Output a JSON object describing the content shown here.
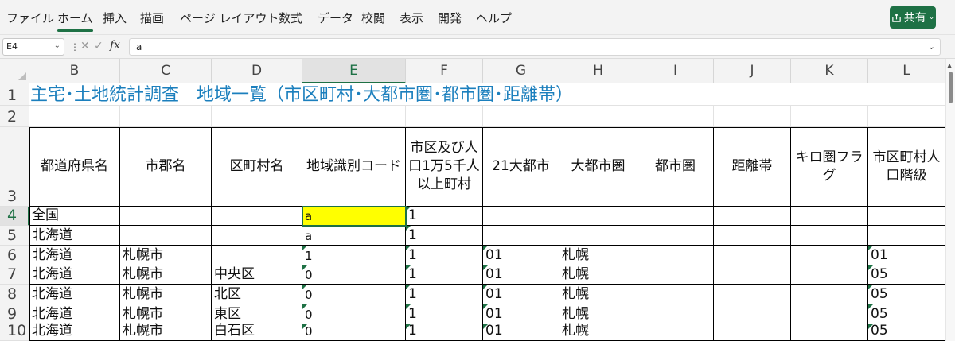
{
  "ribbon": {
    "tabs": [
      "ファイル",
      "ホーム",
      "挿入",
      "描画",
      "ページ レイアウト",
      "数式",
      "データ",
      "校閲",
      "表示",
      "開発",
      "ヘルプ"
    ],
    "active_tab": "ホーム",
    "share_label": "共有",
    "accent_color": "#1e7145"
  },
  "formula_bar": {
    "name_box": "E4",
    "fx_label": "fx",
    "formula": "a"
  },
  "sheet": {
    "columns": [
      "B",
      "C",
      "D",
      "E",
      "F",
      "G",
      "H",
      "I",
      "J",
      "K",
      "L"
    ],
    "selected_column": "E",
    "rows": [
      "1",
      "2",
      "3",
      "4",
      "5",
      "6",
      "7",
      "8",
      "9",
      "10"
    ],
    "selected_row": "4",
    "title": "主宅･土地統計調査　地域一覧（市区町村･大都市圏･都市圏･距離帯）",
    "title_color": "#1b7fbd",
    "headers": [
      "都道府県名",
      "市郡名",
      "区町村名",
      "地域識別コード",
      "市区及び人口1万5千人以上町村",
      "21大都市",
      "大都市圏",
      "都市圏",
      "距離帯",
      "キロ圏フラグ",
      "市区町村人口階級"
    ],
    "data_rows": [
      [
        "全国",
        "",
        "",
        "a",
        "1",
        "",
        "",
        "",
        "",
        "",
        ""
      ],
      [
        "北海道",
        "",
        "",
        "a",
        "1",
        "",
        "",
        "",
        "",
        "",
        ""
      ],
      [
        "北海道",
        "札幌市",
        "",
        "1",
        "1",
        "01",
        "札幌",
        "",
        "",
        "",
        "01"
      ],
      [
        "北海道",
        "札幌市",
        "中央区",
        "0",
        "1",
        "01",
        "札幌",
        "",
        "",
        "",
        "05"
      ],
      [
        "北海道",
        "札幌市",
        "北区",
        "0",
        "1",
        "01",
        "札幌",
        "",
        "",
        "",
        "05"
      ],
      [
        "北海道",
        "札幌市",
        "東区",
        "0",
        "1",
        "01",
        "札幌",
        "",
        "",
        "",
        "05"
      ],
      [
        "北海道",
        "札幌市",
        "白石区",
        "0",
        "1",
        "01",
        "札幌",
        "",
        "",
        "",
        "05"
      ]
    ],
    "selected_cell": "E4",
    "selected_fill": "#ffff00"
  }
}
